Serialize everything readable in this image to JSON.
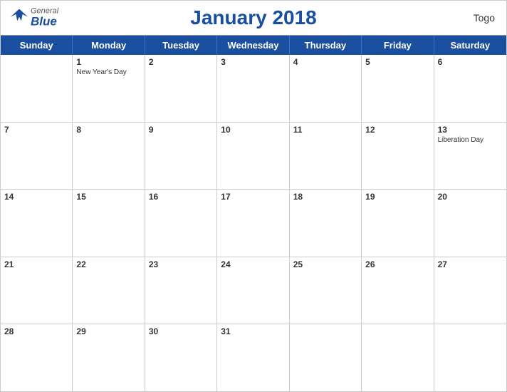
{
  "header": {
    "title": "January 2018",
    "country": "Togo",
    "logo": {
      "line1": "General",
      "line2": "Blue"
    }
  },
  "dayHeaders": [
    "Sunday",
    "Monday",
    "Tuesday",
    "Wednesday",
    "Thursday",
    "Friday",
    "Saturday"
  ],
  "weeks": [
    [
      {
        "day": "",
        "holiday": ""
      },
      {
        "day": "1",
        "holiday": "New Year's Day"
      },
      {
        "day": "2",
        "holiday": ""
      },
      {
        "day": "3",
        "holiday": ""
      },
      {
        "day": "4",
        "holiday": ""
      },
      {
        "day": "5",
        "holiday": ""
      },
      {
        "day": "6",
        "holiday": ""
      }
    ],
    [
      {
        "day": "7",
        "holiday": ""
      },
      {
        "day": "8",
        "holiday": ""
      },
      {
        "day": "9",
        "holiday": ""
      },
      {
        "day": "10",
        "holiday": ""
      },
      {
        "day": "11",
        "holiday": ""
      },
      {
        "day": "12",
        "holiday": ""
      },
      {
        "day": "13",
        "holiday": "Liberation Day"
      }
    ],
    [
      {
        "day": "14",
        "holiday": ""
      },
      {
        "day": "15",
        "holiday": ""
      },
      {
        "day": "16",
        "holiday": ""
      },
      {
        "day": "17",
        "holiday": ""
      },
      {
        "day": "18",
        "holiday": ""
      },
      {
        "day": "19",
        "holiday": ""
      },
      {
        "day": "20",
        "holiday": ""
      }
    ],
    [
      {
        "day": "21",
        "holiday": ""
      },
      {
        "day": "22",
        "holiday": ""
      },
      {
        "day": "23",
        "holiday": ""
      },
      {
        "day": "24",
        "holiday": ""
      },
      {
        "day": "25",
        "holiday": ""
      },
      {
        "day": "26",
        "holiday": ""
      },
      {
        "day": "27",
        "holiday": ""
      }
    ],
    [
      {
        "day": "28",
        "holiday": ""
      },
      {
        "day": "29",
        "holiday": ""
      },
      {
        "day": "30",
        "holiday": ""
      },
      {
        "day": "31",
        "holiday": ""
      },
      {
        "day": "",
        "holiday": ""
      },
      {
        "day": "",
        "holiday": ""
      },
      {
        "day": "",
        "holiday": ""
      }
    ]
  ],
  "colors": {
    "accent": "#1a4fa0",
    "white": "#ffffff",
    "text": "#333333",
    "border": "#cccccc"
  }
}
